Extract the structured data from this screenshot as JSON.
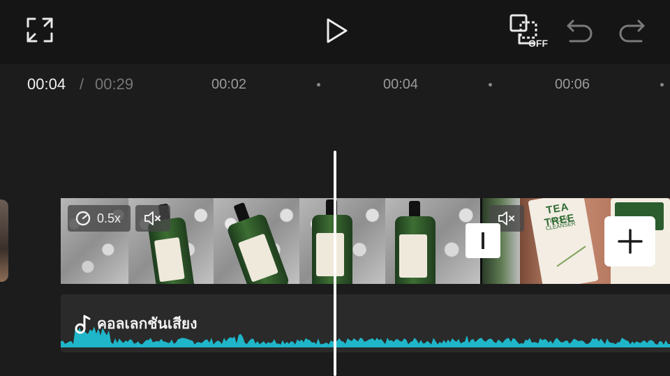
{
  "toolbar": {
    "fullscreen_icon": "fullscreen-icon",
    "play_icon": "play-icon",
    "keyframe_icon": "keyframe-off-icon",
    "keyframe_label": "OFF",
    "undo_icon": "undo-icon",
    "redo_icon": "redo-icon"
  },
  "timecode": {
    "current": "00:04",
    "separator": "/",
    "total": "00:29"
  },
  "ruler": {
    "ticks": [
      "00:02",
      "00:04",
      "00:06"
    ]
  },
  "video_track": {
    "speed_label": "0.5x",
    "speed_icon": "speed-icon",
    "mute_icon": "mute-icon",
    "split_icon": "split-handle-icon",
    "add_icon": "plus-icon",
    "clip2_text": "TEA TREE",
    "clip2_subtext": "FACIAL CLEANSER"
  },
  "audio_track": {
    "label": "คอลเลกชันเสียง",
    "icon": "music-note-icon",
    "waveform_color": "#1fb6c9"
  },
  "colors": {
    "background": "#191919",
    "accent_waveform": "#1fb6c9",
    "playhead": "#ffffff"
  }
}
